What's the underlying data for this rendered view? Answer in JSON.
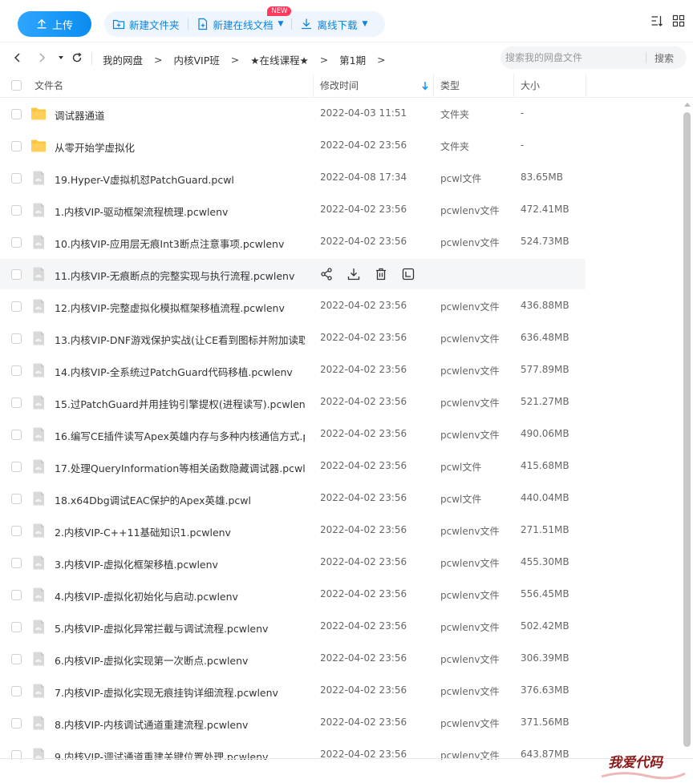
{
  "toolbar": {
    "upload_label": "上传",
    "new_folder_label": "新建文件夹",
    "new_online_doc_label": "新建在线文档",
    "new_badge": "NEW",
    "offline_download_label": "离线下载"
  },
  "nav": {
    "breadcrumbs": [
      "我的网盘",
      "内核VIP班",
      "★在线课程★",
      "第1期"
    ],
    "search_placeholder": "搜索我的网盘文件",
    "search_button": "搜索"
  },
  "table": {
    "headers": {
      "name": "文件名",
      "modified": "修改时间",
      "type": "类型",
      "size": "大小"
    },
    "sort_column": "modified",
    "rows": [
      {
        "name": "调试器通道",
        "time": "2022-04-03 11:51",
        "type": "文件夹",
        "size": "-",
        "icon": "folder-icon"
      },
      {
        "name": "从零开始学虚拟化",
        "time": "2022-04-02 23:56",
        "type": "文件夹",
        "size": "-",
        "icon": "folder-icon"
      },
      {
        "name": "19.Hyper-V虚拟机怼PatchGuard.pcwl",
        "time": "2022-04-08 17:34",
        "type": "pcwl文件",
        "size": "83.65MB",
        "icon": "file-icon"
      },
      {
        "name": "1.内核VIP-驱动框架流程梳理.pcwlenv",
        "time": "2022-04-02 23:56",
        "type": "pcwlenv文件",
        "size": "472.41MB",
        "icon": "file-icon"
      },
      {
        "name": "10.内核VIP-应用层无痕Int3断点注意事项.pcwlenv",
        "time": "2022-04-02 23:56",
        "type": "pcwlenv文件",
        "size": "524.73MB",
        "icon": "file-icon"
      },
      {
        "name": "11.内核VIP-无痕断点的完整实现与执行流程.pcwlenv",
        "time": "",
        "type": "",
        "size": "",
        "icon": "file-icon",
        "hover": true
      },
      {
        "name": "12.内核VIP-完整虚拟化模拟框架移植流程.pcwlenv",
        "time": "2022-04-02 23:56",
        "type": "pcwlenv文件",
        "size": "436.88MB",
        "icon": "file-icon"
      },
      {
        "name": "13.内核VIP-DNF游戏保护实战(让CE看到图标并附加读取...",
        "time": "2022-04-02 23:56",
        "type": "pcwlenv文件",
        "size": "636.48MB",
        "icon": "file-icon"
      },
      {
        "name": "14.内核VIP-全系统过PatchGuard代码移植.pcwlenv",
        "time": "2022-04-02 23:56",
        "type": "pcwlenv文件",
        "size": "577.89MB",
        "icon": "file-icon"
      },
      {
        "name": "15.过PatchGuard并用挂钩引擎提权(进程读写).pcwlenv",
        "time": "2022-04-02 23:56",
        "type": "pcwlenv文件",
        "size": "521.27MB",
        "icon": "file-icon"
      },
      {
        "name": "16.编写CE插件读写Apex英雄内存与多种内核通信方式.p...",
        "time": "2022-04-02 23:56",
        "type": "pcwlenv文件",
        "size": "490.06MB",
        "icon": "file-icon"
      },
      {
        "name": "17.处理QueryInformation等相关函数隐藏调试器.pcwl",
        "time": "2022-04-02 23:56",
        "type": "pcwl文件",
        "size": "415.68MB",
        "icon": "file-icon"
      },
      {
        "name": "18.x64Dbg调试EAC保护的Apex英雄.pcwl",
        "time": "2022-04-02 23:56",
        "type": "pcwl文件",
        "size": "440.04MB",
        "icon": "file-icon"
      },
      {
        "name": "2.内核VIP-C++11基础知识1.pcwlenv",
        "time": "2022-04-02 23:56",
        "type": "pcwlenv文件",
        "size": "271.51MB",
        "icon": "file-icon"
      },
      {
        "name": "3.内核VIP-虚拟化框架移植.pcwlenv",
        "time": "2022-04-02 23:56",
        "type": "pcwlenv文件",
        "size": "455.30MB",
        "icon": "file-icon"
      },
      {
        "name": "4.内核VIP-虚拟化初始化与启动.pcwlenv",
        "time": "2022-04-02 23:56",
        "type": "pcwlenv文件",
        "size": "556.45MB",
        "icon": "file-icon"
      },
      {
        "name": "5.内核VIP-虚拟化异常拦截与调试流程.pcwlenv",
        "time": "2022-04-02 23:56",
        "type": "pcwlenv文件",
        "size": "502.42MB",
        "icon": "file-icon"
      },
      {
        "name": "6.内核VIP-虚拟化实现第一次断点.pcwlenv",
        "time": "2022-04-02 23:56",
        "type": "pcwlenv文件",
        "size": "306.39MB",
        "icon": "file-icon"
      },
      {
        "name": "7.内核VIP-虚拟化实现无痕挂钩详细流程.pcwlenv",
        "time": "2022-04-02 23:56",
        "type": "pcwlenv文件",
        "size": "376.63MB",
        "icon": "file-icon"
      },
      {
        "name": "8.内核VIP-内核调试通道重建流程.pcwlenv",
        "time": "2022-04-02 23:56",
        "type": "pcwlenv文件",
        "size": "371.56MB",
        "icon": "file-icon"
      },
      {
        "name": "9.内核VIP-调试通道重建关键位置处理.pcwlenv",
        "time": "2022-04-02 23:56",
        "type": "pcwlenv文件",
        "size": "643.87MB",
        "icon": "file-icon"
      }
    ]
  },
  "watermark": {
    "text": "我爱代码"
  },
  "colors": {
    "accent": "#0b8cf0",
    "folder": "#ffc53d",
    "badge": "#ff3b5c",
    "hover_row": "#f5f6f8"
  }
}
